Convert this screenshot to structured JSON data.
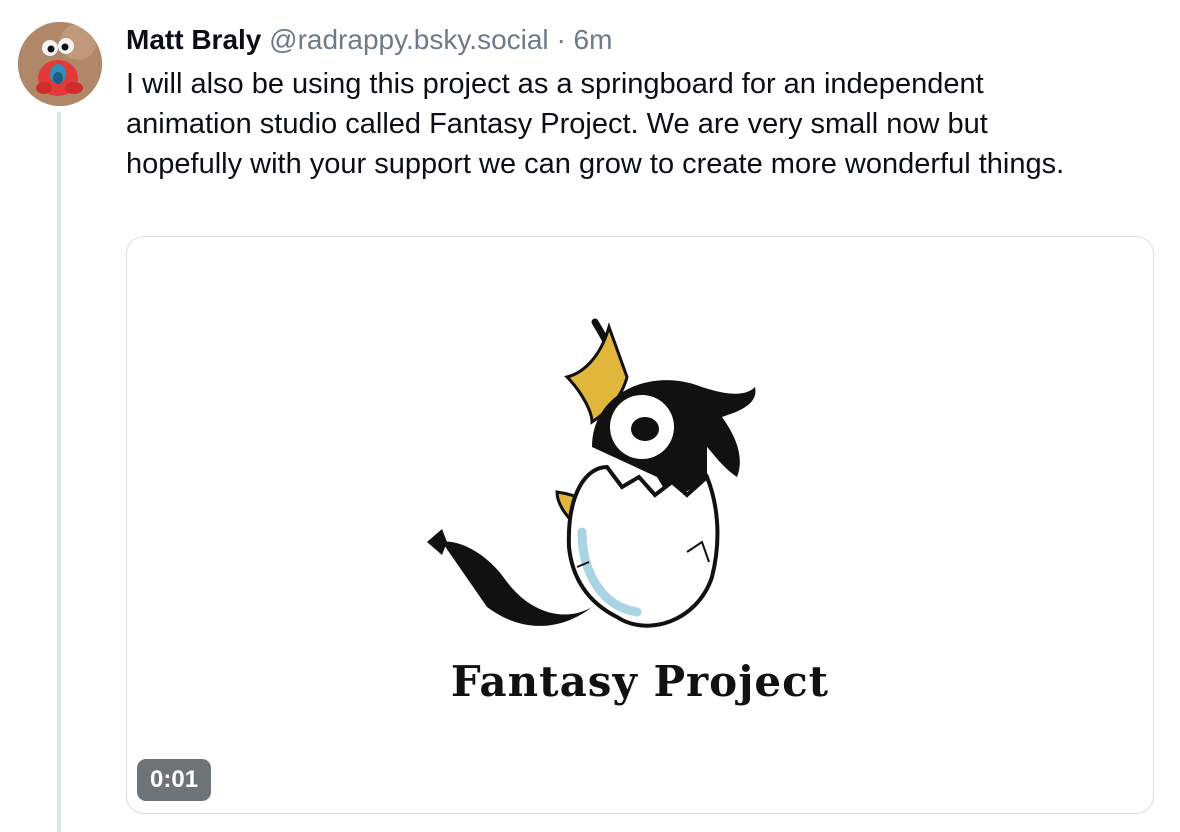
{
  "post": {
    "author_name": "Matt Braly",
    "handle": "@radrappy.bsky.social",
    "separator": "·",
    "time": "6m",
    "text": "I will also be using this project as a springboard for an independent animation studio called Fantasy Project. We are very small now but hopefully with your support we can grow to create more wonderful things."
  },
  "media": {
    "logo_text": "Fantasy Project",
    "duration": "0:01",
    "colors": {
      "wing": "#e0b63b",
      "body": "#111111",
      "egg_shadow": "#a8d4e4"
    }
  }
}
